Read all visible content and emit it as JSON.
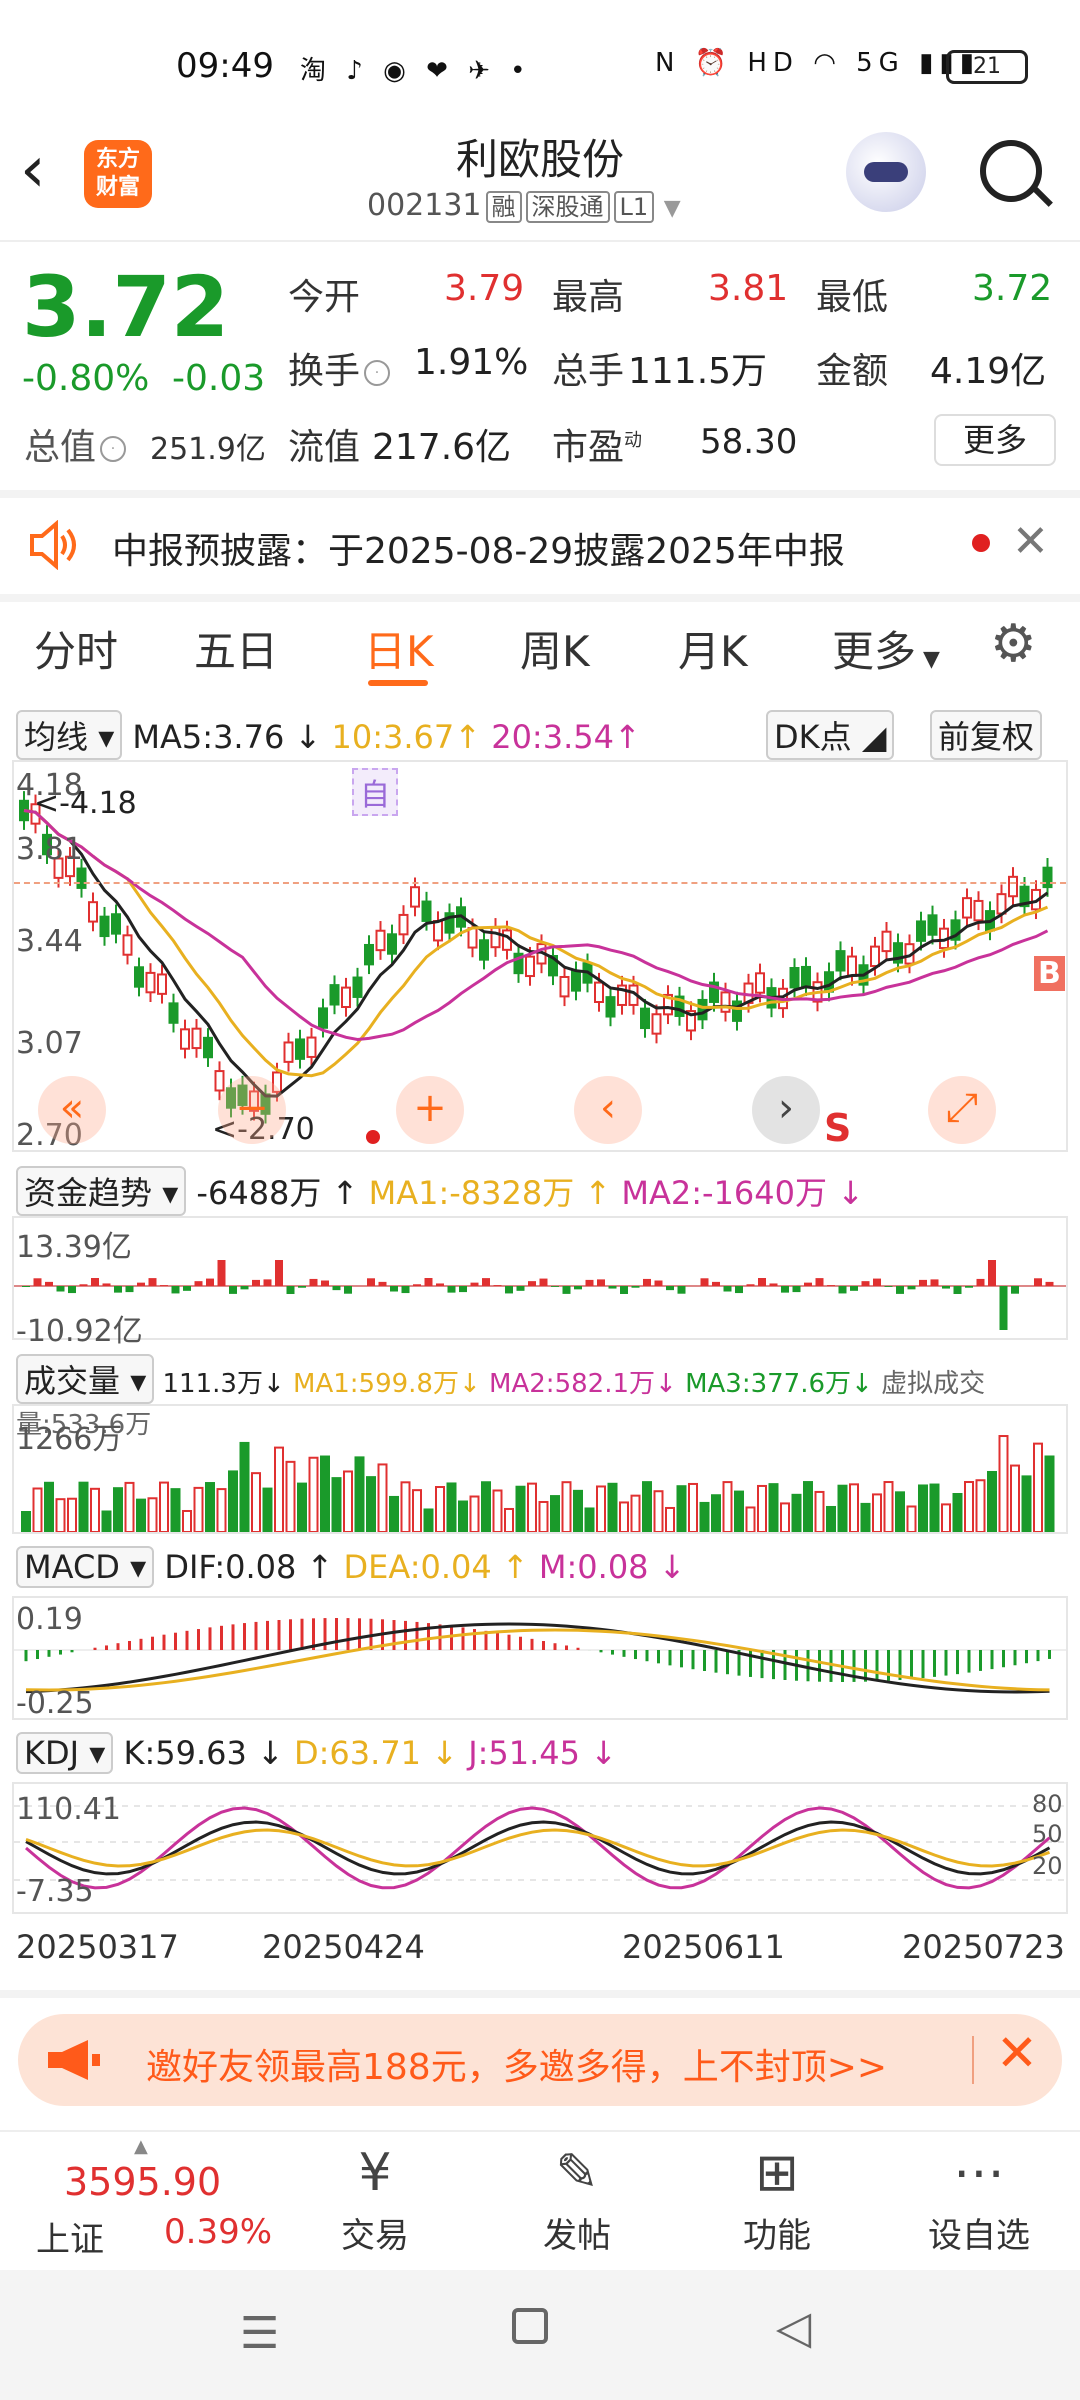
{
  "status_bar": {
    "time": "09:49",
    "battery": "21",
    "network": "5G"
  },
  "header": {
    "title": "利欧股份",
    "code": "002131",
    "tags": [
      "融",
      "深股通",
      "L1"
    ],
    "logo": "东方\n财富"
  },
  "quote": {
    "price": "3.72",
    "change_pct": "-0.80%",
    "change": "-0.03",
    "open_label": "今开",
    "open": "3.79",
    "high_label": "最高",
    "high": "3.81",
    "low_label": "最低",
    "low": "3.72",
    "turnover_label": "换手",
    "turnover": "1.91%",
    "volume_label": "总手",
    "volume": "111.5万",
    "amount_label": "金额",
    "amount": "4.19亿",
    "mcap_label": "总值",
    "mcap": "251.9亿",
    "float_label": "流值",
    "float": "217.6亿",
    "pe_label": "市盈",
    "pe_sup": "动",
    "pe": "58.30",
    "more": "更多"
  },
  "notice": {
    "text": "中报预披露：于2025-08-29披露2025年中报"
  },
  "tabs": [
    {
      "label": "分时"
    },
    {
      "label": "五日"
    },
    {
      "label": "日K"
    },
    {
      "label": "周K"
    },
    {
      "label": "月K"
    },
    {
      "label": "更多"
    }
  ],
  "kline": {
    "indicator": "均线",
    "ma5": "MA5:3.76",
    "ma10": "10:3.67",
    "ma20": "20:3.54",
    "dk_button": "DK点",
    "adjust_button": "前复权",
    "y_ticks": [
      "4.18",
      "3.81",
      "3.44",
      "3.07",
      "2.70"
    ],
    "high_marker": "<-4.18",
    "low_marker": "<-2.70",
    "self_tag": "自",
    "sell_tag": "S",
    "buy_tag": "B",
    "ma5_color": "#222222",
    "ma10_color": "#e8b020",
    "ma20_color": "#c8329a"
  },
  "fund": {
    "indicator": "资金趋势",
    "value": "-6488万",
    "ma1": "MA1:-8328万",
    "ma2": "MA2:-1640万",
    "top": "13.39亿",
    "bottom": "-10.92亿"
  },
  "volume": {
    "indicator": "成交量",
    "value": "111.3万",
    "ma1": "MA1:599.8万",
    "ma2": "MA2:582.1万",
    "ma3": "MA3:377.6万",
    "virtual": "虚拟成交量:533.6万",
    "top": "1266万"
  },
  "macd": {
    "indicator": "MACD",
    "dif": "DIF:0.08",
    "dea": "DEA:0.04",
    "m": "M:0.08",
    "top": "0.19",
    "bottom": "-0.25"
  },
  "kdj": {
    "indicator": "KDJ",
    "k": "K:59.63",
    "d": "D:63.71",
    "j": "J:51.45",
    "top": "110.41",
    "bottom": "-7.35",
    "r80": "80",
    "r50": "50",
    "r20": "20"
  },
  "dates": [
    "20250317",
    "20250424",
    "20250611",
    "20250723"
  ],
  "banner": {
    "text": "邀好友领最高188元，多邀多得，上不封顶>>"
  },
  "bottom_bar": {
    "index_value": "3595.90",
    "index_name": "上证",
    "index_pct": "0.39%",
    "items": [
      {
        "label": "交易",
        "icon": "yen-icon"
      },
      {
        "label": "发帖",
        "icon": "edit-icon"
      },
      {
        "label": "功能",
        "icon": "grid-icon"
      },
      {
        "label": "设自选",
        "icon": "more-icon"
      }
    ]
  }
}
